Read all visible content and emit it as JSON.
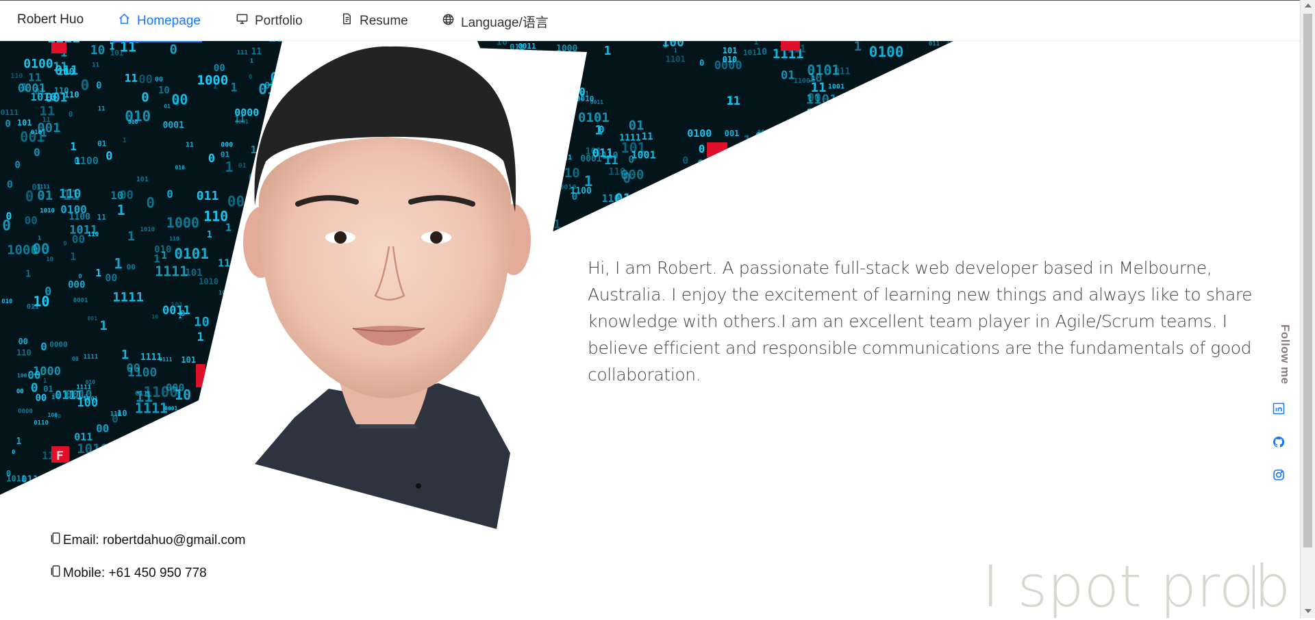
{
  "nav": {
    "brand": "Robert Huo",
    "items": [
      {
        "label": "Homepage",
        "icon": "home-icon",
        "active": true
      },
      {
        "label": "Portfolio",
        "icon": "desktop-icon",
        "active": false
      },
      {
        "label": "Resume",
        "icon": "file-icon",
        "active": false
      },
      {
        "label": "Language/语言",
        "icon": "globe-icon",
        "active": false
      }
    ],
    "accent": "#1677ff"
  },
  "intro": {
    "text": "Hi, I am Robert. A passionate full-stack web developer based in Melbourne, Australia. I enjoy the excitement of learning new things and always like to share knowledge with others.I am an excellent team player in Agile/Scrum teams. I believe efficient and responsible communications are the fundamentals of good collaboration."
  },
  "contact": {
    "email": "Email: robertdahuo@gmail.com",
    "mobile": "Mobile: +61 450 950 778"
  },
  "follow": {
    "label": "Follow me",
    "links": [
      {
        "icon": "linkedin-icon"
      },
      {
        "icon": "github-icon"
      },
      {
        "icon": "instagram-icon"
      }
    ],
    "color": "#1677ff"
  },
  "slogan": {
    "text": "I spot prob"
  },
  "colors": {
    "matrix_bg": "#03141b",
    "matrix_digit": "#19d3ff",
    "matrix_red": "#e0102a"
  }
}
